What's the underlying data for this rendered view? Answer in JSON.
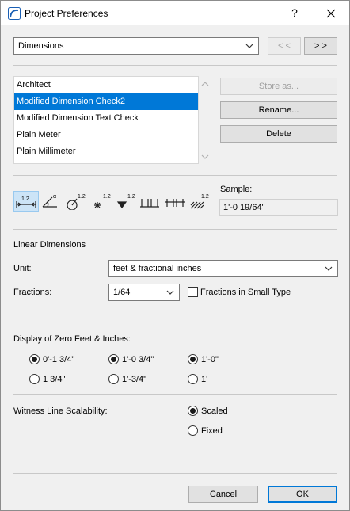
{
  "window": {
    "title": "Project Preferences",
    "help_label": "?",
    "close_label": "✕"
  },
  "page_select": {
    "value": "Dimensions"
  },
  "nav": {
    "prev_label": "< <",
    "next_label": "> >"
  },
  "schemes": {
    "items": [
      {
        "label": "Architect",
        "selected": false
      },
      {
        "label": "Modified Dimension Check2",
        "selected": true
      },
      {
        "label": "Modified Dimension Text Check",
        "selected": false
      },
      {
        "label": "Plain Meter",
        "selected": false
      },
      {
        "label": "Plain Millimeter",
        "selected": false
      }
    ],
    "store_as_label": "Store as...",
    "rename_label": "Rename...",
    "delete_label": "Delete"
  },
  "tools": {
    "items": [
      {
        "name": "linear-dimension-icon",
        "text": "1.2",
        "active": true
      },
      {
        "name": "angular-dimension-icon",
        "text": "α",
        "active": false
      },
      {
        "name": "radial-dimension-icon",
        "text": "1.2",
        "active": false
      },
      {
        "name": "level-dimension-icon",
        "text": "1.2",
        "active": false
      },
      {
        "name": "elevation-marker-icon",
        "text": "1.2",
        "active": false
      },
      {
        "name": "door-window-dimension-icon",
        "text": "",
        "active": false
      },
      {
        "name": "sill-height-icon",
        "text": "",
        "active": false
      },
      {
        "name": "area-dimension-icon",
        "text": "1.2 m²",
        "active": false
      }
    ]
  },
  "sample": {
    "label": "Sample:",
    "value": "1'-0 19/64\""
  },
  "linear": {
    "section_title": "Linear Dimensions",
    "unit_label": "Unit:",
    "unit_value": "feet & fractional inches",
    "fractions_label": "Fractions:",
    "fractions_value": "1/64",
    "small_type_label": "Fractions in Small Type",
    "small_type_checked": false
  },
  "zero_display": {
    "title": "Display of Zero Feet & Inches:",
    "options": [
      {
        "label": "0'-1 3/4\"",
        "checked": true
      },
      {
        "label": "1 3/4\"",
        "checked": false
      },
      {
        "label": "1'-0 3/4\"",
        "checked": true
      },
      {
        "label": "1'-3/4\"",
        "checked": false
      },
      {
        "label": "1'-0\"",
        "checked": true
      },
      {
        "label": "1'",
        "checked": false
      }
    ]
  },
  "witness": {
    "label": "Witness Line Scalability:",
    "scaled_label": "Scaled",
    "fixed_label": "Fixed",
    "scaled_checked": true
  },
  "footer": {
    "cancel_label": "Cancel",
    "ok_label": "OK"
  }
}
